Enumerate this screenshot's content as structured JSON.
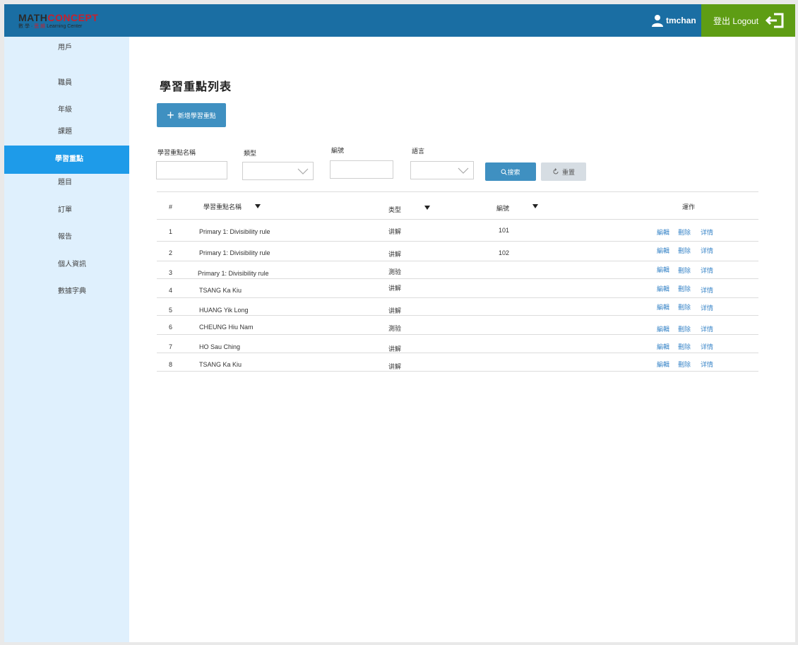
{
  "header": {
    "logo_line1_a": "MATH",
    "logo_line1_b": "CONCEPT",
    "logo_line2_a": "數 學 ·",
    "logo_line2_b": "思 維",
    "logo_line2_c": "Learning Center",
    "username": "tmchan",
    "logout_label": "登出 Logout",
    "user_icon": "user-icon",
    "logout_icon": "logout-icon"
  },
  "sidebar": {
    "items": [
      {
        "label": "用戶"
      },
      {
        "label": "職員"
      },
      {
        "label": "年級"
      },
      {
        "label": "課題"
      },
      {
        "label": "學習重點",
        "active": true
      },
      {
        "label": "題目"
      },
      {
        "label": "訂單"
      },
      {
        "label": "報告"
      },
      {
        "label": "個人資訊"
      },
      {
        "label": "數據字典"
      }
    ]
  },
  "page": {
    "title": "學習重點列表",
    "add_button": "新增學習重點"
  },
  "filters": {
    "name_label": "學習重點名稱",
    "type_label": "類型",
    "code_label": "編號",
    "language_label": "語言",
    "name_value": "",
    "type_value": "",
    "code_value": "",
    "language_value": "",
    "search_button": "搜索",
    "reset_button": "重置"
  },
  "table": {
    "headers": {
      "index": "#",
      "name": "學習重點名稱",
      "type": "类型",
      "code": "編號",
      "actions": "運作"
    },
    "action_labels": {
      "edit": "編輯",
      "delete": "刪除",
      "detail": "详情"
    },
    "rows": [
      {
        "index": "1",
        "name": "Primary 1: Divisibility rule",
        "type": "讲解",
        "code": "101"
      },
      {
        "index": "2",
        "name": "Primary 1: Divisibility rule",
        "type": "讲解",
        "code": "102"
      },
      {
        "index": "3",
        "name": "Primary 1: Divisibility rule",
        "type": "測验",
        "code": ""
      },
      {
        "index": "4",
        "name": "TSANG Ka Kiu",
        "type": "讲解",
        "code": ""
      },
      {
        "index": "5",
        "name": "HUANG Yik Long",
        "type": "讲解",
        "code": ""
      },
      {
        "index": "6",
        "name": "CHEUNG Hiu Nam",
        "type": "測验",
        "code": ""
      },
      {
        "index": "7",
        "name": "HO Sau Ching",
        "type": "讲解",
        "code": ""
      },
      {
        "index": "8",
        "name": "TSANG Ka Kiu",
        "type": "讲解",
        "code": ""
      }
    ]
  },
  "colors": {
    "topbar": "#1a6ea3",
    "logout": "#5e9d14",
    "sidebar": "#dff0fd",
    "active_nav": "#1e9be9",
    "primary_button": "#3f90c1",
    "link": "#3a86c8"
  }
}
